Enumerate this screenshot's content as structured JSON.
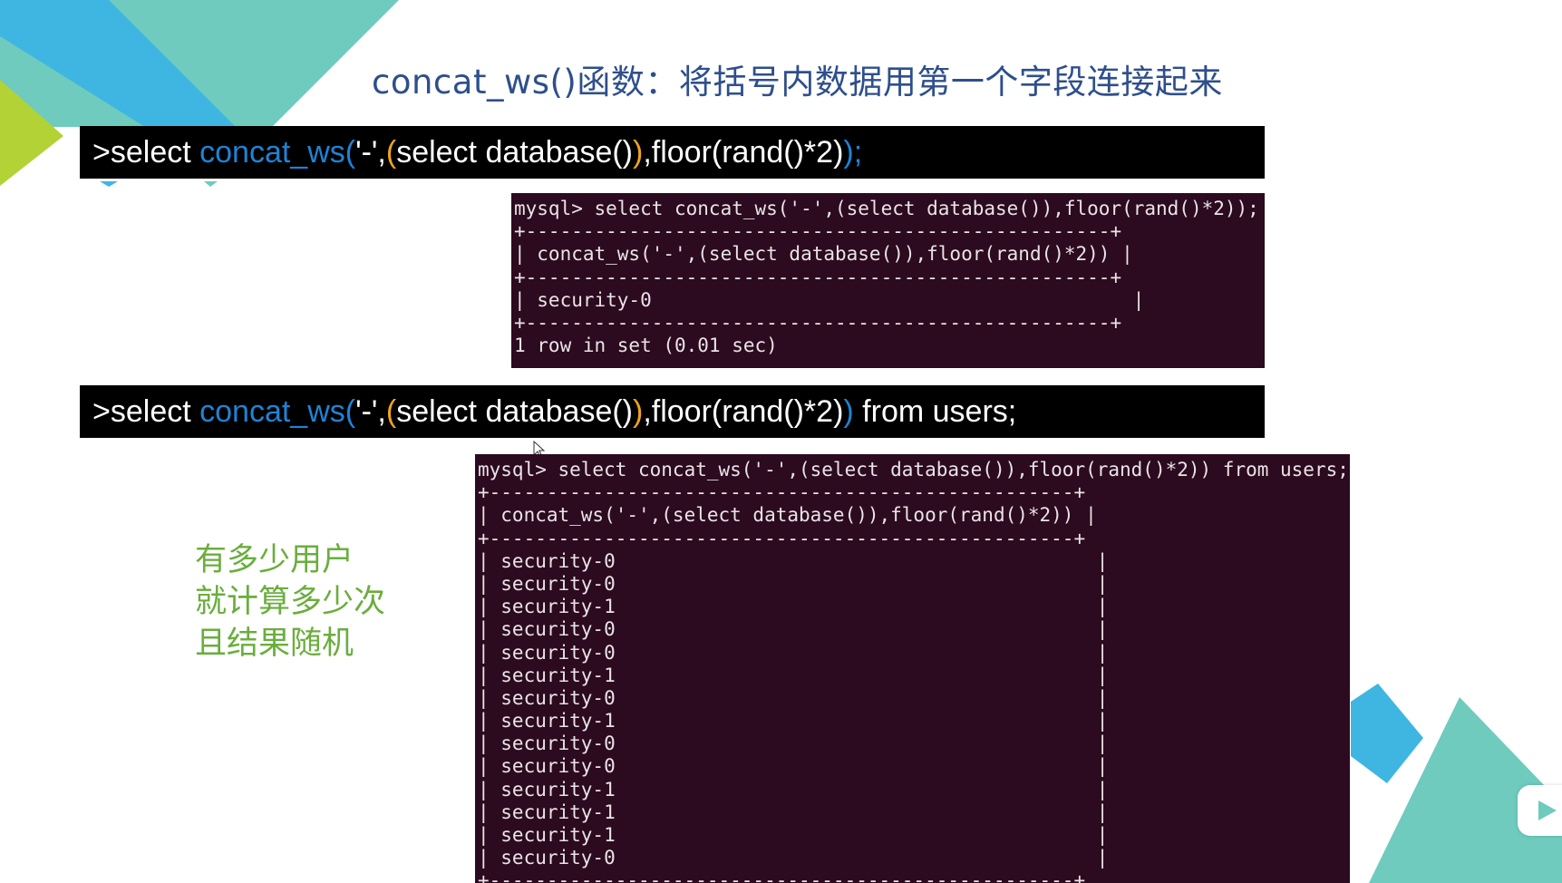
{
  "slide": {
    "title": "concat_ws()函数：将括号内数据用第一个字段连接起来"
  },
  "query1": {
    "prompt": ">select ",
    "fn": "concat_ws",
    "open": "(",
    "sep": "'-',",
    "sub_open": "(",
    "sub_body": "select database()",
    "sub_close": ")",
    "rest": ",floor(rand()*2)",
    "close": ")",
    "tail": ";"
  },
  "terminal1": {
    "lines": [
      "mysql> select concat_ws('-',(select database()),floor(rand()*2));",
      "+---------------------------------------------------+",
      "| concat_ws('-',(select database()),floor(rand()*2)) |",
      "+---------------------------------------------------+",
      "| security-0                                          |",
      "+---------------------------------------------------+",
      "1 row in set (0.01 sec)"
    ]
  },
  "query2": {
    "prompt": ">select ",
    "fn": "concat_ws",
    "open": "(",
    "sep": "'-',",
    "sub_open": "(",
    "sub_body": "select database()",
    "sub_close": ")",
    "rest": ",floor(rand()*2)",
    "close": ")",
    "tail": " from users;"
  },
  "terminal2": {
    "lines": [
      "mysql> select concat_ws('-',(select database()),floor(rand()*2)) from users;",
      "+---------------------------------------------------+",
      "| concat_ws('-',(select database()),floor(rand()*2)) |",
      "+---------------------------------------------------+",
      "| security-0                                          |",
      "| security-0                                          |",
      "| security-1                                          |",
      "| security-0                                          |",
      "| security-0                                          |",
      "| security-1                                          |",
      "| security-0                                          |",
      "| security-1                                          |",
      "| security-0                                          |",
      "| security-0                                          |",
      "| security-1                                          |",
      "| security-1                                          |",
      "| security-1                                          |",
      "| security-0                                          |",
      "+---------------------------------------------------+"
    ]
  },
  "annotation": {
    "line1": "有多少用户",
    "line2": "就计算多少次",
    "line3": "且结果随机"
  },
  "colors": {
    "title": "#2e4f8c",
    "function_name": "#1f83d4",
    "paren": "#f0a419",
    "terminal_bg": "#2c0a1f",
    "annotation": "#6aae3e",
    "deco_teal": "#6ecbbd",
    "deco_blue": "#3fb6e1",
    "deco_lime": "#b3d235"
  },
  "icons": {
    "cursor": "mouse-pointer-icon",
    "player": "play-icon"
  }
}
